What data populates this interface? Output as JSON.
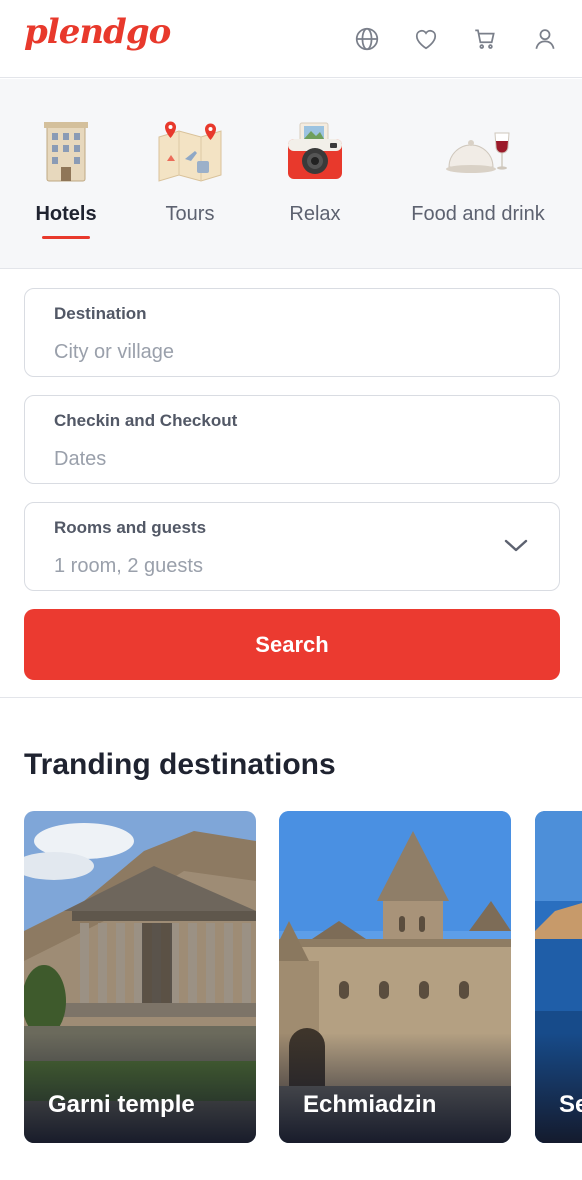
{
  "brand": {
    "logo_text": "plendgo",
    "accent": "#eb3a30"
  },
  "header": {
    "icons": [
      "globe-icon",
      "heart-icon",
      "cart-icon",
      "user-icon"
    ]
  },
  "categories": {
    "active": "Hotels",
    "items": [
      {
        "label": "Hotels",
        "icon": "hotel-building-icon"
      },
      {
        "label": "Tours",
        "icon": "tour-map-icon"
      },
      {
        "label": "Relax",
        "icon": "camera-icon"
      },
      {
        "label": "Food and drink",
        "icon": "food-cloche-icon"
      }
    ]
  },
  "search_form": {
    "destination": {
      "label": "Destination",
      "placeholder": "City or village"
    },
    "dates": {
      "label": "Checkin and Checkout",
      "placeholder": "Dates"
    },
    "rooms": {
      "label": "Rooms and guests",
      "value": "1 room, 2 guests"
    },
    "submit_label": "Search"
  },
  "trending": {
    "title": "Tranding destinations",
    "cards": [
      {
        "name": "Garni temple"
      },
      {
        "name": "Echmiadzin"
      },
      {
        "name": "Se"
      }
    ]
  }
}
